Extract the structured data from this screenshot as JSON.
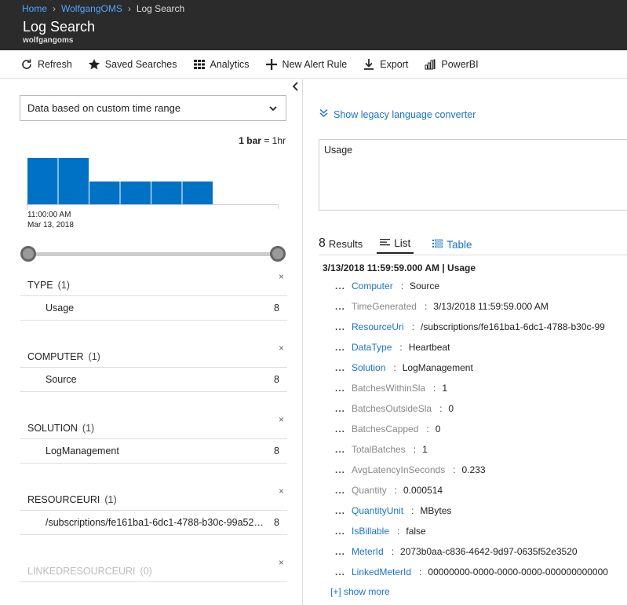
{
  "breadcrumb": {
    "home": "Home",
    "workspace": "WolfgangOMS",
    "current": "Log Search"
  },
  "header": {
    "title": "Log Search",
    "subtitle": "wolfgangoms"
  },
  "toolbar": {
    "refresh": "Refresh",
    "saved_searches": "Saved Searches",
    "analytics": "Analytics",
    "new_alert_rule": "New Alert Rule",
    "export": "Export",
    "powerbi": "PowerBI"
  },
  "time_range": {
    "selected": "Data based on custom time range"
  },
  "histogram": {
    "legend_value": "1 bar",
    "legend_unit": "= 1hr",
    "start_time": "11:00:00 AM",
    "start_date": "Mar 13, 2018",
    "bars": [
      1,
      1,
      0.5,
      0.5,
      0.5,
      0.5
    ],
    "color": "#0072c6"
  },
  "facets": [
    {
      "name": "TYPE",
      "count": "(1)",
      "rows": [
        {
          "label": "Usage",
          "value": "8"
        }
      ]
    },
    {
      "name": "COMPUTER",
      "count": "(1)",
      "rows": [
        {
          "label": "Source",
          "value": "8"
        }
      ]
    },
    {
      "name": "SOLUTION",
      "count": "(1)",
      "rows": [
        {
          "label": "LogManagement",
          "value": "8"
        }
      ]
    },
    {
      "name": "RESOURCEURI",
      "count": "(1)",
      "rows": [
        {
          "label": "/subscriptions/fe161ba1-6dc1-4788-b30c-99a52bd1...",
          "value": "8"
        }
      ]
    },
    {
      "name": "LINKEDRESOURCEURI",
      "count": "(0)",
      "rows": []
    }
  ],
  "close_glyph": "×",
  "legacy_converter": "Show legacy language converter",
  "query_text": "Usage",
  "results": {
    "count": "8",
    "label": "Results",
    "tab_list": "List",
    "tab_table": "Table"
  },
  "record": {
    "title": "3/13/2018 11:59:59.000 AM | Usage",
    "fields": [
      {
        "name": "Computer",
        "value": "Source",
        "link": true
      },
      {
        "name": "TimeGenerated",
        "value": "3/13/2018 11:59:59.000 AM",
        "link": false
      },
      {
        "name": "ResourceUri",
        "value": "/subscriptions/fe161ba1-6dc1-4788-b30c-99",
        "link": true
      },
      {
        "name": "DataType",
        "value": "Heartbeat",
        "link": true
      },
      {
        "name": "Solution",
        "value": "LogManagement",
        "link": true
      },
      {
        "name": "BatchesWithinSla",
        "value": "1",
        "link": false
      },
      {
        "name": "BatchesOutsideSla",
        "value": "0",
        "link": false
      },
      {
        "name": "BatchesCapped",
        "value": "0",
        "link": false
      },
      {
        "name": "TotalBatches",
        "value": "1",
        "link": false
      },
      {
        "name": "AvgLatencyInSeconds",
        "value": "0.233",
        "link": false
      },
      {
        "name": "Quantity",
        "value": "0.000514",
        "link": false
      },
      {
        "name": "QuantityUnit",
        "value": "MBytes",
        "link": true
      },
      {
        "name": "IsBillable",
        "value": "false",
        "link": true
      },
      {
        "name": "MeterId",
        "value": "2073b0aa-c836-4642-9d97-0635f52e3520",
        "link": true
      },
      {
        "name": "LinkedMeterId",
        "value": "00000000-0000-0000-0000-000000000000",
        "link": true
      }
    ],
    "show_more": "[+] show more"
  }
}
